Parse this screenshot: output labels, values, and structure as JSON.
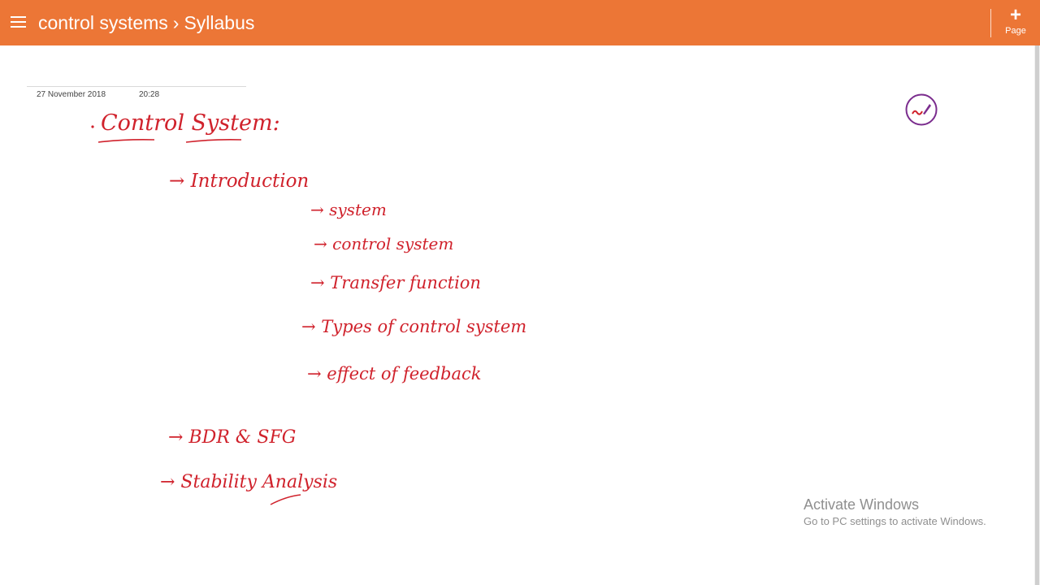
{
  "header": {
    "notebook": "control systems",
    "separator": "›",
    "page_title": "Syllabus",
    "add_page_label": "Page",
    "menu_icon": "hamburger-menu-icon",
    "add_icon": "plus-icon"
  },
  "page": {
    "date": "27 November 2018",
    "time": "20:28"
  },
  "notes": {
    "title": "Control System:",
    "items": [
      "→ Introduction",
      "→ system",
      "→ control system",
      "→ Transfer function",
      "→ Types of control system",
      "→ effect of feedback",
      "→ BDR & SFG",
      "→ Stability Analysis"
    ]
  },
  "watermark": {
    "title": "Activate Windows",
    "subtitle": "Go to PC settings to activate Windows."
  },
  "colors": {
    "header_bg": "#ec7636",
    "ink": "#d0222c",
    "pen_icon": "#7b2d8e"
  }
}
